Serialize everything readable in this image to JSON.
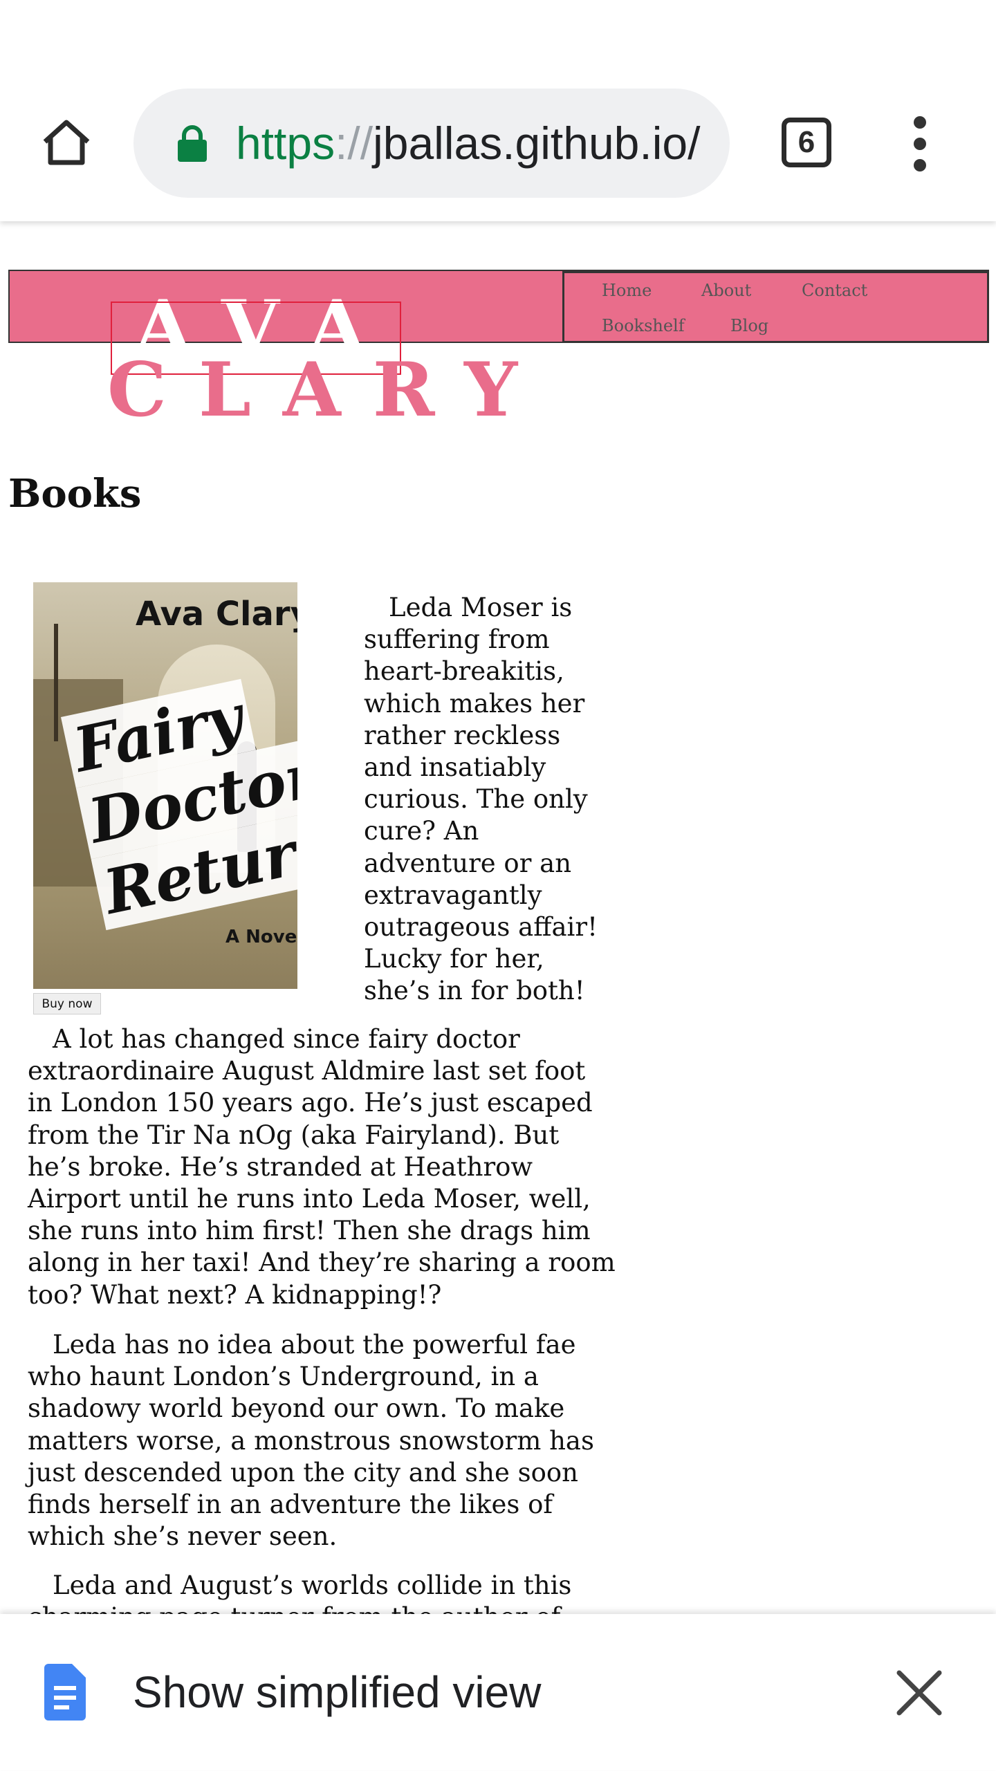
{
  "browser": {
    "url_scheme": "https",
    "url_sep": "://",
    "url_host": "jballas.github.io/",
    "tab_count": "6"
  },
  "site": {
    "logo_first": "AVA",
    "logo_last": "CLARY",
    "brand_color": "#e96d8b",
    "nav": {
      "home": "Home",
      "about": "About",
      "contact": "Contact",
      "bookshelf": "Bookshelf",
      "blog": "Blog"
    }
  },
  "page": {
    "title": "Books"
  },
  "book": {
    "cover_author": "Ava Clary",
    "cover_title_1": "Fairy",
    "cover_title_2": "Doctor",
    "cover_title_3": "Returns",
    "cover_subtitle": "A Novel",
    "buy_label": "Buy now",
    "blurb": "Leda Moser is suffering from heart-breakitis, which makes her rather reckless and insatiably curious. The only cure? An adventure or an extravagantly outrageous affair! Lucky for her, she’s in for both!",
    "paragraphs": [
      "A lot has changed since fairy doctor extraordinaire August Aldmire last set foot in London 150 years ago. He’s just escaped from the Tir Na nOg (aka Fairyland). But he’s broke. He’s stranded at Heathrow Airport until he runs into Leda Moser, well, she runs into him first! Then she drags him along in her taxi! And they’re sharing a room too? What next? A kidnapping!?",
      "Leda has no idea about the powerful fae who haunt London’s Underground, in a shadowy world beyond our own. To make matters worse, a monstrous snowstorm has just descended upon the city and she soon finds herself in an adventure the likes of which she’s never seen.",
      "Leda and August’s worlds collide in this charming page turner from the author of"
    ]
  },
  "infobar": {
    "label": "Show simplified view",
    "icon": "document-icon"
  }
}
